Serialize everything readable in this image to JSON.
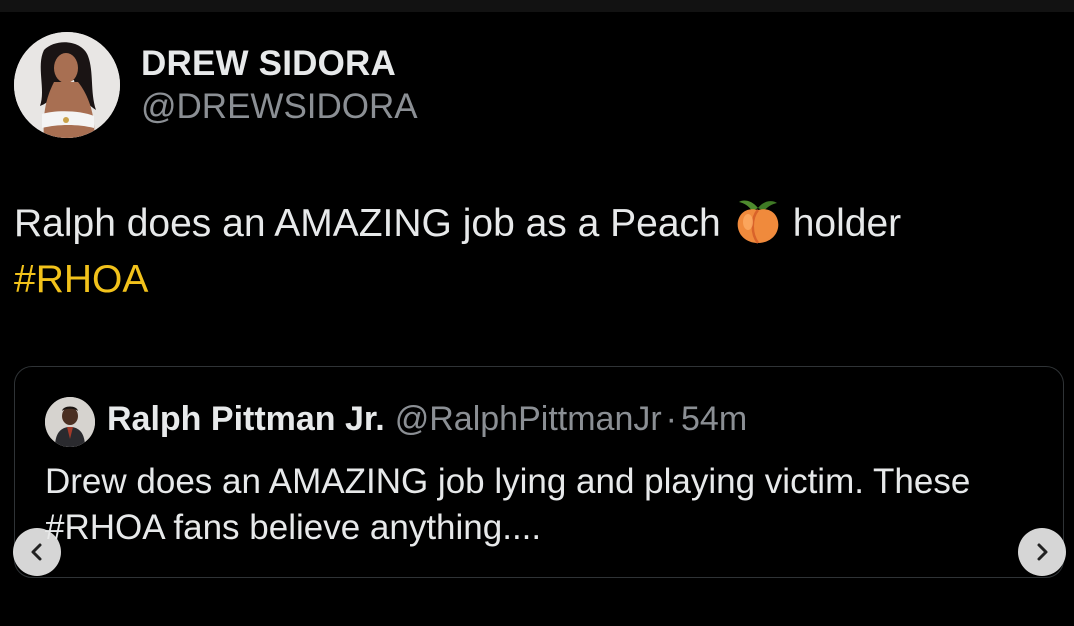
{
  "author": {
    "display_name": "DREW SIDORA",
    "handle": "@DREWSIDORA",
    "avatar_icon": "profile-photo"
  },
  "tweet": {
    "text_before_emoji": "Ralph does an AMAZING job as a Peach",
    "emoji": "peach",
    "text_after_emoji": "holder",
    "hashtag": "#RHOA"
  },
  "quoted_tweet": {
    "display_name": "Ralph Pittman Jr.",
    "handle": "@RalphPittmanJr",
    "separator": "·",
    "time": "54m",
    "text_line1": "Drew does an AMAZING job lying and playing victim. These",
    "text_line2": "#RHOA fans believe anything...."
  },
  "carousel": {
    "prev_icon": "chevron-left-icon",
    "next_icon": "chevron-right-icon"
  },
  "colors": {
    "background": "#000000",
    "primary_text": "#e7e9ea",
    "secondary_text": "#8b8f94",
    "hashtag": "#f2c21b",
    "card_border": "#2f3336"
  }
}
